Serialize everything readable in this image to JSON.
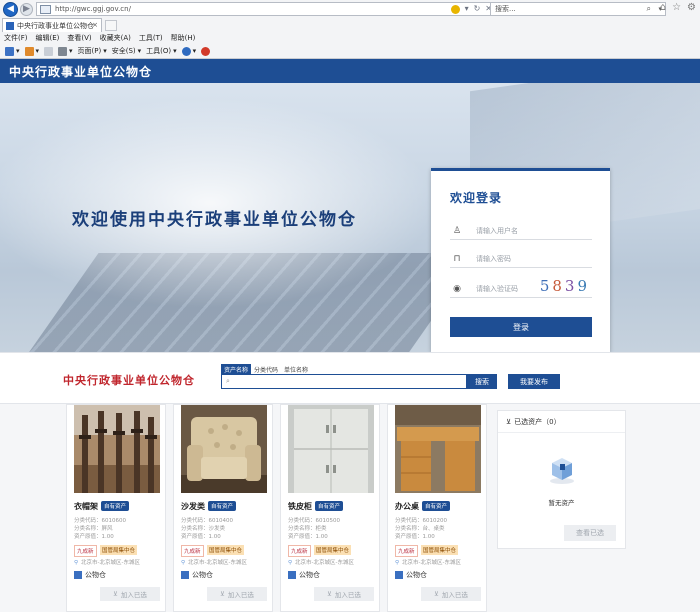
{
  "browser": {
    "url": "http://gwc.ggj.gov.cn/",
    "search_placeholder": "搜索...",
    "tab_title": "中央行政事业单位公物仓",
    "menu": [
      "文件(F)",
      "编辑(E)",
      "查看(V)",
      "收藏夹(A)",
      "工具(T)",
      "帮助(H)"
    ],
    "commands": [
      "页面(P)",
      "安全(S)",
      "工具(O)"
    ]
  },
  "site": {
    "header_title": "中央行政事业单位公物仓",
    "hero_welcome": "欢迎使用中央行政事业单位公物仓"
  },
  "login": {
    "title": "欢迎登录",
    "username_placeholder": "请输入用户名",
    "password_placeholder": "请输入密码",
    "captcha_placeholder": "请输入验证码",
    "captcha": [
      "5",
      "8",
      "3",
      "9"
    ],
    "submit": "登录"
  },
  "portal": {
    "logo": "中央行政事业单位公物仓",
    "search_tabs": [
      "资产名称",
      "分类代码",
      "单位名称"
    ],
    "search_button": "搜索",
    "publish_button": "我要发布"
  },
  "listings": [
    {
      "name": "衣帽架",
      "tag": "自有资产",
      "code": "分类代码：6010600",
      "cat": "分类名称：屏风",
      "value": "资产原值：1.00",
      "cond": "九成新",
      "center": "国管局集中仓",
      "location": "北京市-北京城区-东城区",
      "warehouse": "公物仓",
      "add": "加入已选"
    },
    {
      "name": "沙发类",
      "tag": "自有资产",
      "code": "分类代码：6010400",
      "cat": "分类名称：沙发类",
      "value": "资产原值：1.00",
      "cond": "九成新",
      "center": "国管局集中仓",
      "location": "北京市-北京城区-东城区",
      "warehouse": "公物仓",
      "add": "加入已选"
    },
    {
      "name": "铁皮柜",
      "tag": "自有资产",
      "code": "分类代码：6010500",
      "cat": "分类名称：柜类",
      "value": "资产原值：1.00",
      "cond": "九成新",
      "center": "国管局集中仓",
      "location": "北京市-北京城区-东城区",
      "warehouse": "公物仓",
      "add": "加入已选"
    },
    {
      "name": "办公桌",
      "tag": "自有资产",
      "code": "分类代码：6010200",
      "cat": "分类名称：台、桌类",
      "value": "资产原值：1.00",
      "cond": "九成新",
      "center": "国管局集中仓",
      "location": "北京市-北京城区-东城区",
      "warehouse": "公物仓",
      "add": "加入已选"
    }
  ],
  "selected": {
    "title": "已选资产（0）",
    "empty": "暂无资产",
    "view_button": "查看已选"
  }
}
